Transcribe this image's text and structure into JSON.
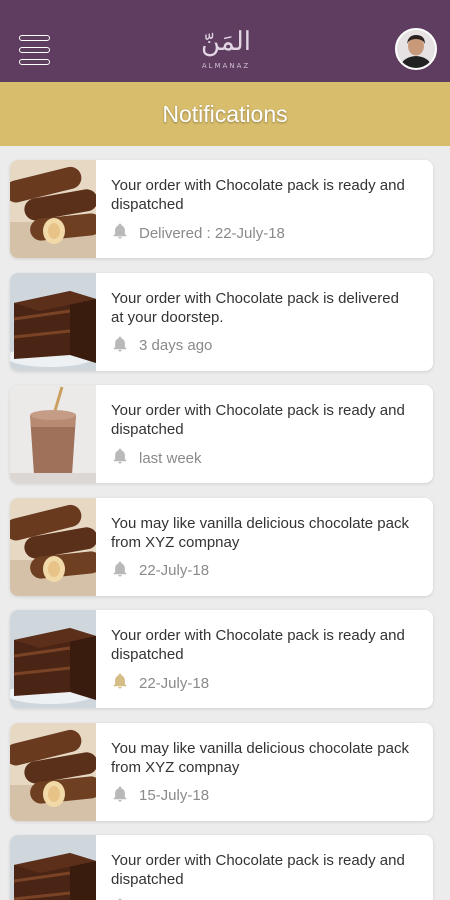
{
  "header": {
    "logo_text": "المَنّ",
    "logo_subtitle": "ALMANAZ",
    "menu_icon": "hamburger-menu-icon",
    "avatar_icon": "user-avatar"
  },
  "page": {
    "title": "Notifications"
  },
  "notifications": [
    {
      "image": "chocolate-bars",
      "message": "Your order with Chocolate pack is ready and dispatched",
      "meta": "Delivered : 22-July-18",
      "bell_color": "#b9b9b9"
    },
    {
      "image": "chocolate-cake",
      "message": "Your order with Chocolate pack is delivered at your doorstep.",
      "meta": "3 days ago",
      "bell_color": "#b9b9b9"
    },
    {
      "image": "chocolate-drink",
      "message": "Your order with Chocolate pack is ready and dispatched",
      "meta": "last week",
      "bell_color": "#b9b9b9"
    },
    {
      "image": "chocolate-bars",
      "message": "You may like vanilla delicious chocolate pack from XYZ compnay",
      "meta": "22-July-18",
      "bell_color": "#b9b9b9"
    },
    {
      "image": "chocolate-cake",
      "message": "Your order with Chocolate pack is ready and dispatched",
      "meta": "22-July-18",
      "bell_color": "#d6bc85"
    },
    {
      "image": "chocolate-bars",
      "message": "You may like vanilla delicious chocolate pack from XYZ compnay",
      "meta": "15-July-18",
      "bell_color": "#b9b9b9"
    },
    {
      "image": "chocolate-cake",
      "message": "Your order with Chocolate pack is ready and dispatched",
      "meta": "",
      "bell_color": "#b9b9b9"
    }
  ],
  "colors": {
    "header": "#5e3d60",
    "title_bar": "#d8bd6c",
    "background": "#ececec"
  }
}
